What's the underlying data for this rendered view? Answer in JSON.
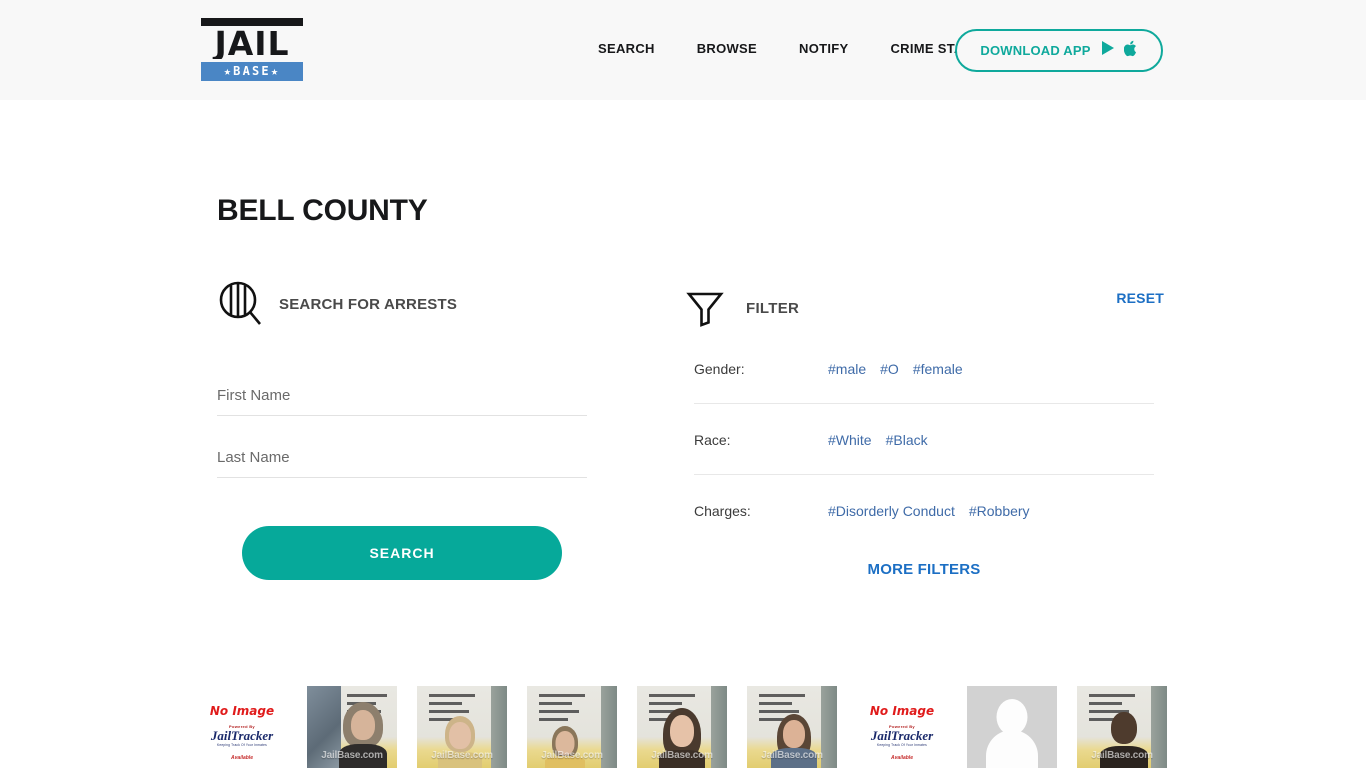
{
  "header": {
    "logo": {
      "bar": "",
      "top_text": "JAIL",
      "bottom_text": "★BASE★"
    },
    "nav": [
      {
        "label": "SEARCH",
        "name": "nav-search"
      },
      {
        "label": "BROWSE",
        "name": "nav-browse"
      },
      {
        "label": "NOTIFY",
        "name": "nav-notify"
      },
      {
        "label": "CRIME STATS",
        "name": "nav-crime-stats"
      }
    ],
    "download_button": {
      "label": "DOWNLOAD APP",
      "icons": [
        "google-play-icon",
        "apple-icon"
      ],
      "accent_color": "#0fa99c"
    }
  },
  "page": {
    "title": "BELL COUNTY"
  },
  "search": {
    "icon": "jail-bars-magnifier-icon",
    "heading": "SEARCH FOR ARRESTS",
    "first_name": {
      "value": "",
      "placeholder": "First Name"
    },
    "last_name": {
      "value": "",
      "placeholder": "Last Name"
    },
    "submit_label": "SEARCH",
    "button_color": "#06a99a"
  },
  "filter": {
    "icon": "funnel-icon",
    "heading": "FILTER",
    "reset_label": "RESET",
    "link_color": "#1c6fc4",
    "tag_color": "#3f6ba8",
    "rows": [
      {
        "label": "Gender:",
        "tags": [
          "#male",
          "#O",
          "#female"
        ]
      },
      {
        "label": "Race:",
        "tags": [
          "#White",
          "#Black"
        ]
      },
      {
        "label": "Charges:",
        "tags": [
          "#Disorderly Conduct",
          "#Robbery"
        ]
      }
    ],
    "more_filters_label": "MORE FILTERS"
  },
  "thumbnails": {
    "watermark": "JailBase.com",
    "no_image": {
      "title": "No Image",
      "powered_by": "Powered By",
      "brand": "JailTracker",
      "brand_sub": "Keeping Track Of Your Inmates",
      "footer": "Available"
    },
    "items": [
      {
        "type": "no-image",
        "name": "thumbnail-no-image-1"
      },
      {
        "type": "mugshot",
        "name": "thumbnail-mugshot-2"
      },
      {
        "type": "mugshot",
        "name": "thumbnail-mugshot-3"
      },
      {
        "type": "mugshot",
        "name": "thumbnail-mugshot-4"
      },
      {
        "type": "mugshot",
        "name": "thumbnail-mugshot-5"
      },
      {
        "type": "mugshot",
        "name": "thumbnail-mugshot-6"
      },
      {
        "type": "no-image",
        "name": "thumbnail-no-image-7"
      },
      {
        "type": "avatar-placeholder",
        "name": "thumbnail-avatar-placeholder-8"
      },
      {
        "type": "mugshot",
        "name": "thumbnail-mugshot-9"
      }
    ]
  }
}
